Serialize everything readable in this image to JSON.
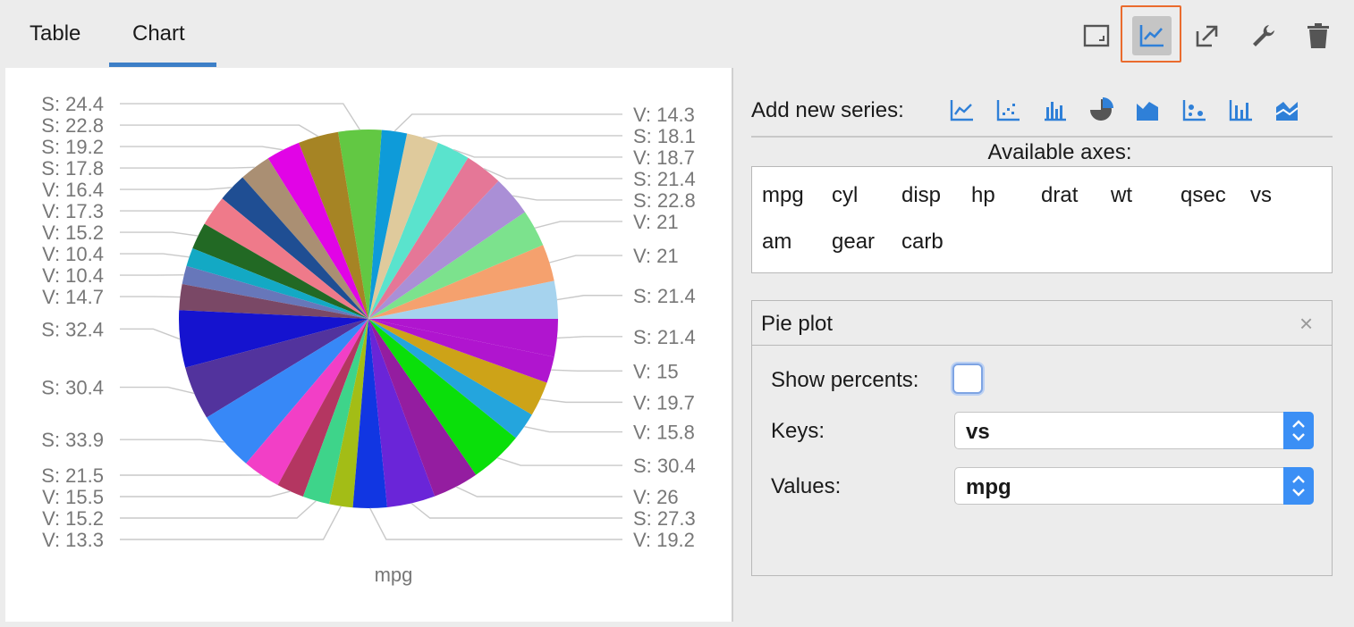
{
  "tabs": [
    {
      "label": "Table"
    },
    {
      "label": "Chart"
    }
  ],
  "toolbar": {
    "icons": [
      "fit-frame-icon",
      "line-chart-icon",
      "export-icon",
      "wrench-icon",
      "trash-icon"
    ],
    "active": "line-chart-icon",
    "active_frame_color": "#ea6b2d"
  },
  "sidebar": {
    "add_series_label": "Add new series:",
    "series_types": [
      "line",
      "scatter",
      "bar",
      "pie",
      "area",
      "bubble",
      "grouped-bar",
      "stacked-area"
    ],
    "axes_title": "Available axes:",
    "axes": [
      "mpg",
      "cyl",
      "disp",
      "hp",
      "drat",
      "wt",
      "qsec",
      "vs",
      "am",
      "gear",
      "carb"
    ]
  },
  "pie_plot": {
    "title": "Pie plot",
    "close": "×",
    "show_percents_label": "Show percents:",
    "show_percents": false,
    "keys_label": "Keys:",
    "keys_value": "vs",
    "values_label": "Values:",
    "values_value": "mpg"
  },
  "chart_data": {
    "type": "pie",
    "xlabel": "mpg",
    "slices": [
      {
        "label": "S: 21.4",
        "value": 21.4,
        "color": "#a6d3ee"
      },
      {
        "label": "V: 21",
        "value": 21,
        "color": "#f5a16e"
      },
      {
        "label": "V: 21",
        "value": 21,
        "color": "#7ce28d"
      },
      {
        "label": "S: 22.8",
        "value": 22.8,
        "color": "#aa8fd6"
      },
      {
        "label": "S: 21.4",
        "value": 21.4,
        "color": "#e57797"
      },
      {
        "label": "V: 18.7",
        "value": 18.7,
        "color": "#5ae3cd"
      },
      {
        "label": "S: 18.1",
        "value": 18.1,
        "color": "#dfca9c"
      },
      {
        "label": "V: 14.3",
        "value": 14.3,
        "color": "#0e9bd9"
      },
      {
        "label": "S: 24.4",
        "value": 24.4,
        "color": "#62c843"
      },
      {
        "label": "S: 22.8",
        "value": 22.8,
        "color": "#a68424"
      },
      {
        "label": "S: 19.2",
        "value": 19.2,
        "color": "#e104e6"
      },
      {
        "label": "S: 17.8",
        "value": 17.8,
        "color": "#aa8f73"
      },
      {
        "label": "V: 16.4",
        "value": 16.4,
        "color": "#1f4e93"
      },
      {
        "label": "V: 17.3",
        "value": 17.3,
        "color": "#ef7a8a"
      },
      {
        "label": "V: 15.2",
        "value": 15.2,
        "color": "#226924"
      },
      {
        "label": "V: 10.4",
        "value": 10.4,
        "color": "#13a9c4"
      },
      {
        "label": "V: 10.4",
        "value": 10.4,
        "color": "#6777ba"
      },
      {
        "label": "V: 14.7",
        "value": 14.7,
        "color": "#7a4866"
      },
      {
        "label": "S: 32.4",
        "value": 32.4,
        "color": "#1513cf"
      },
      {
        "label": "S: 30.4",
        "value": 30.4,
        "color": "#52339d"
      },
      {
        "label": "S: 33.9",
        "value": 33.9,
        "color": "#3788f7"
      },
      {
        "label": "S: 21.5",
        "value": 21.5,
        "color": "#f23fc6"
      },
      {
        "label": "V: 15.5",
        "value": 15.5,
        "color": "#b43661"
      },
      {
        "label": "V: 15.2",
        "value": 15.2,
        "color": "#3ed48a"
      },
      {
        "label": "V: 13.3",
        "value": 13.3,
        "color": "#a3bd16"
      },
      {
        "label": "V: 19.2",
        "value": 19.2,
        "color": "#1136e2"
      },
      {
        "label": "S: 27.3",
        "value": 27.3,
        "color": "#6a25d8"
      },
      {
        "label": "V: 26",
        "value": 26,
        "color": "#941da0"
      },
      {
        "label": "S: 30.4",
        "value": 30.4,
        "color": "#0adf0a"
      },
      {
        "label": "V: 15.8",
        "value": 15.8,
        "color": "#24a5dd"
      },
      {
        "label": "V: 19.7",
        "value": 19.7,
        "color": "#cda318"
      },
      {
        "label": "V: 15",
        "value": 15,
        "color": "#b015cf"
      },
      {
        "label": "S: 21.4",
        "value": 21.4,
        "color": "#b015cf"
      }
    ]
  }
}
